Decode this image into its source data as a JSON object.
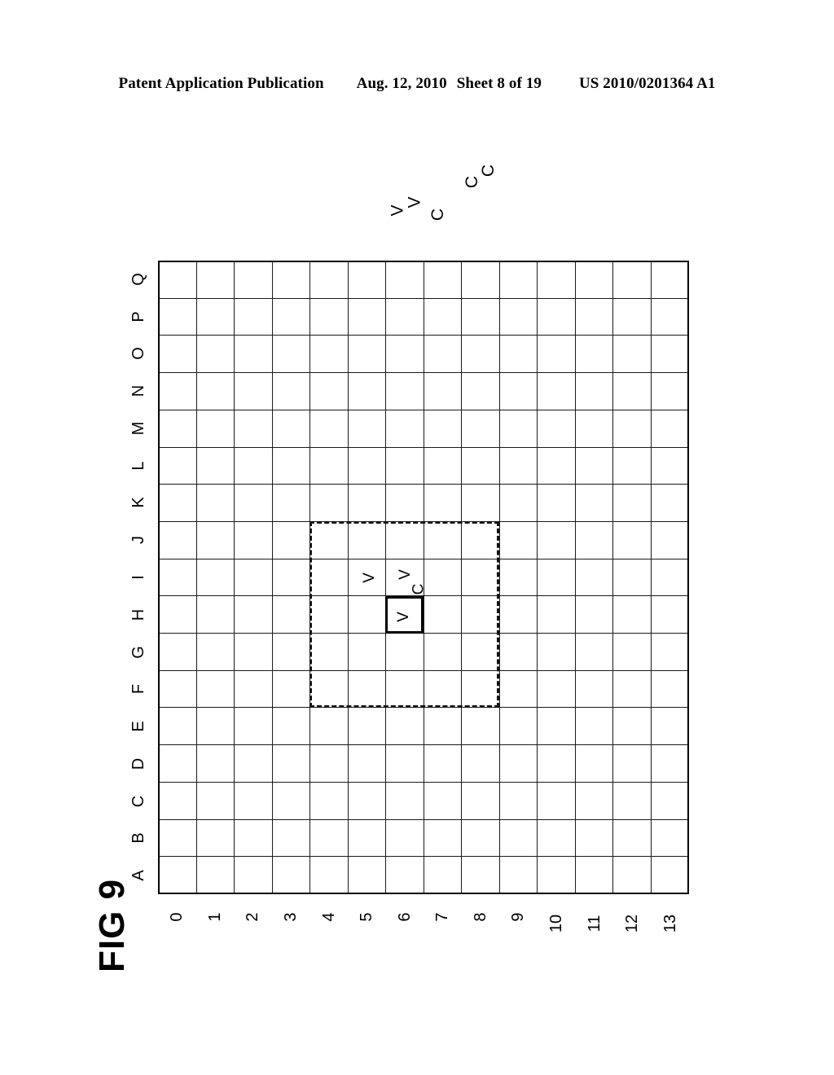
{
  "header": {
    "publication": "Patent Application Publication",
    "date": "Aug. 12, 2010",
    "sheet": "Sheet 8 of 19",
    "patent_number": "US 2010/0201364 A1"
  },
  "figure": {
    "label": "FIG 9",
    "grid": {
      "columns": 14,
      "rows": 17,
      "column_labels": [
        "0",
        "1",
        "2",
        "3",
        "4",
        "5",
        "6",
        "7",
        "8",
        "9",
        "10",
        "11",
        "12",
        "13"
      ],
      "row_labels": [
        "A",
        "B",
        "C",
        "D",
        "E",
        "F",
        "G",
        "H",
        "I",
        "J",
        "K",
        "L",
        "M",
        "N",
        "O",
        "P",
        "Q"
      ]
    },
    "marks": [
      {
        "row": "H",
        "col": "5",
        "text": "V"
      },
      {
        "row": "I",
        "col": "5",
        "text": "V"
      },
      {
        "row": "I",
        "col": "5b",
        "text": "C"
      },
      {
        "row": "H",
        "col": "6",
        "text": "V"
      }
    ],
    "cell_glyphs": {
      "v": "V",
      "c": "C"
    },
    "highlight_cell": {
      "row": "H",
      "col": "6",
      "label": "V"
    },
    "dashed_region": {
      "from_row": "F",
      "to_row": "J",
      "from_col": "4",
      "to_col": "8"
    },
    "annotations": [
      {
        "text": "V",
        "id": "anno-v-1"
      },
      {
        "text": "V",
        "id": "anno-v-2"
      },
      {
        "text": "C",
        "id": "anno-c-1"
      },
      {
        "text": "C",
        "id": "anno-c-2"
      },
      {
        "text": "C",
        "id": "anno-c-3"
      }
    ]
  },
  "colors": {
    "ink": "#000000",
    "grid_line": "#1a1a1a",
    "paper": "#ffffff"
  }
}
